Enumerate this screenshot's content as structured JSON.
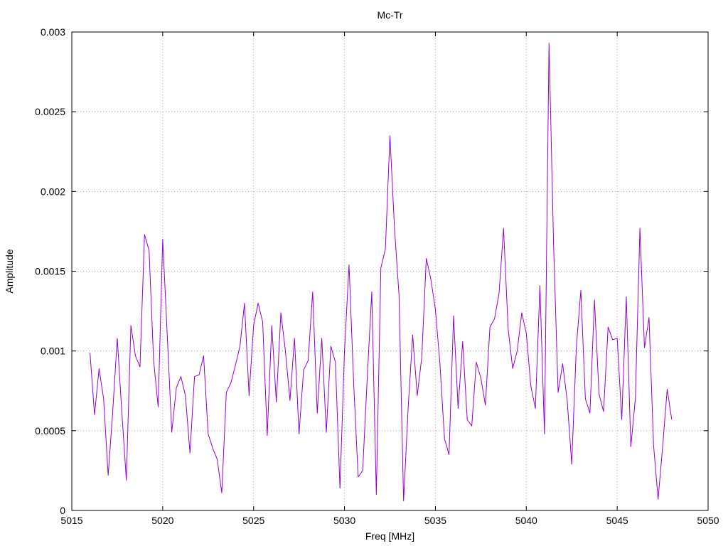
{
  "chart_data": {
    "type": "line",
    "title": "Mc-Tr",
    "xlabel": "Freq [MHz]",
    "ylabel": "Amplitude",
    "xlim": [
      5015,
      5050
    ],
    "ylim": [
      0,
      0.003
    ],
    "grid": true,
    "colors": {
      "series": "#9400d3"
    },
    "x_ticks": [
      "5015",
      "5020",
      "5025",
      "5030",
      "5035",
      "5040",
      "5045",
      "5050"
    ],
    "y_ticks": [
      "0",
      "0.0005",
      "0.001",
      "0.0015",
      "0.002",
      "0.0025",
      "0.003"
    ],
    "series": [
      {
        "x": [
          5016.0,
          5016.25,
          5016.5,
          5016.75,
          5017.0,
          5017.25,
          5017.5,
          5017.75,
          5018.0,
          5018.25,
          5018.5,
          5018.75,
          5019.0,
          5019.25,
          5019.5,
          5019.75,
          5020.0,
          5020.25,
          5020.5,
          5020.75,
          5021.0,
          5021.25,
          5021.5,
          5021.75,
          5022.0,
          5022.25,
          5022.5,
          5022.75,
          5023.0,
          5023.25,
          5023.5,
          5023.75,
          5024.0,
          5024.25,
          5024.5,
          5024.75,
          5025.0,
          5025.25,
          5025.5,
          5025.75,
          5026.0,
          5026.25,
          5026.5,
          5026.75,
          5027.0,
          5027.25,
          5027.5,
          5027.75,
          5028.0,
          5028.25,
          5028.5,
          5028.75,
          5029.0,
          5029.25,
          5029.5,
          5029.75,
          5030.0,
          5030.25,
          5030.5,
          5030.75,
          5031.0,
          5031.25,
          5031.5,
          5031.75,
          5032.0,
          5032.25,
          5032.5,
          5032.75,
          5033.0,
          5033.25,
          5033.5,
          5033.75,
          5034.0,
          5034.25,
          5034.5,
          5034.75,
          5035.0,
          5035.25,
          5035.5,
          5035.75,
          5036.0,
          5036.25,
          5036.5,
          5036.75,
          5037.0,
          5037.25,
          5037.5,
          5037.75,
          5038.0,
          5038.25,
          5038.5,
          5038.75,
          5039.0,
          5039.25,
          5039.5,
          5039.75,
          5040.0,
          5040.25,
          5040.5,
          5040.75,
          5041.0,
          5041.25,
          5041.5,
          5041.75,
          5042.0,
          5042.25,
          5042.5,
          5042.75,
          5043.0,
          5043.25,
          5043.5,
          5043.75,
          5044.0,
          5044.25,
          5044.5,
          5044.75,
          5045.0,
          5045.25,
          5045.5,
          5045.75,
          5046.0,
          5046.25,
          5046.5,
          5046.75,
          5047.0,
          5047.25,
          5047.5,
          5047.75,
          5048.0
        ],
        "y": [
          0.00099,
          0.0006,
          0.00089,
          0.0007,
          0.00022,
          0.00062,
          0.00108,
          0.00062,
          0.00019,
          0.00116,
          0.00097,
          0.0009,
          0.00173,
          0.00163,
          0.00094,
          0.00065,
          0.0017,
          0.0011,
          0.00049,
          0.00077,
          0.00084,
          0.00072,
          0.00036,
          0.00084,
          0.00085,
          0.00097,
          0.00048,
          0.00039,
          0.00032,
          0.00011,
          0.00074,
          0.0008,
          0.00091,
          0.00103,
          0.0013,
          0.00072,
          0.00116,
          0.0013,
          0.00118,
          0.00047,
          0.00116,
          0.00068,
          0.00124,
          0.001,
          0.00069,
          0.00108,
          0.00048,
          0.00088,
          0.00094,
          0.00137,
          0.00061,
          0.00108,
          0.00049,
          0.00103,
          0.00093,
          0.00014,
          0.001,
          0.00154,
          0.00081,
          0.00021,
          0.00025,
          0.00083,
          0.00137,
          0.0001,
          0.00152,
          0.00164,
          0.00235,
          0.00177,
          0.00135,
          6e-05,
          0.00064,
          0.0011,
          0.00072,
          0.00096,
          0.00158,
          0.00145,
          0.00126,
          0.00092,
          0.00045,
          0.00035,
          0.00122,
          0.00064,
          0.00106,
          0.00057,
          0.00053,
          0.00093,
          0.00083,
          0.00066,
          0.00115,
          0.0012,
          0.00136,
          0.00177,
          0.00114,
          0.00089,
          0.001,
          0.00124,
          0.00111,
          0.00078,
          0.00064,
          0.00141,
          0.00048,
          0.00293,
          0.00167,
          0.00074,
          0.00092,
          0.00069,
          0.00029,
          0.00102,
          0.00138,
          0.0007,
          0.00061,
          0.00132,
          0.00073,
          0.00062,
          0.00115,
          0.00107,
          0.00108,
          0.00057,
          0.00134,
          0.0004,
          0.0007,
          0.00177,
          0.00102,
          0.00121,
          0.00041,
          7e-05,
          0.0004,
          0.00076,
          0.00057
        ]
      }
    ]
  }
}
